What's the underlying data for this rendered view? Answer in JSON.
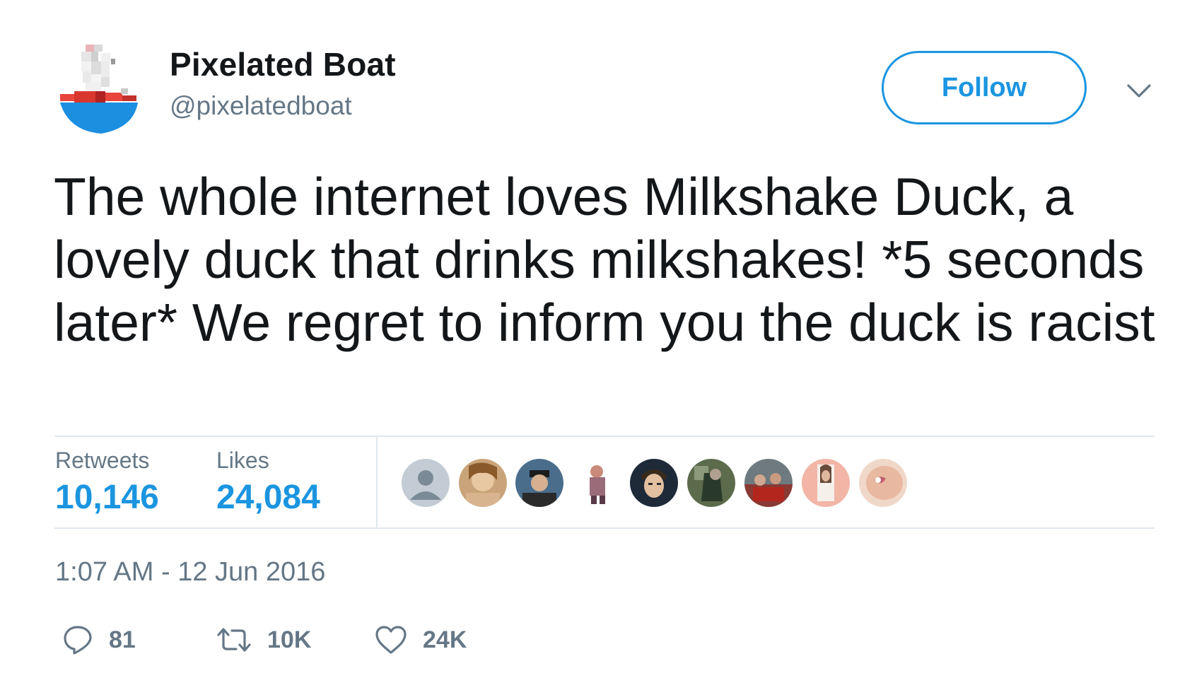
{
  "user": {
    "display_name": "Pixelated Boat",
    "handle": "@pixelatedboat",
    "avatar_icon": "pixelated-boat-avatar"
  },
  "header": {
    "follow_label": "Follow",
    "menu_icon": "chevron-down-icon"
  },
  "tweet": {
    "text": "The whole internet loves Milkshake Duck, a lovely duck that drinks milkshakes! *5 seconds later* We regret to inform you the duck is racist"
  },
  "stats": {
    "retweets_label": "Retweets",
    "retweets_value": "10,146",
    "likes_label": "Likes",
    "likes_value": "24,084",
    "liker_avatar_count": 9
  },
  "timestamp": "1:07 AM - 12 Jun 2016",
  "actions": {
    "reply": {
      "icon": "reply-icon",
      "count": "81"
    },
    "retweet": {
      "icon": "retweet-icon",
      "count": "10K"
    },
    "like": {
      "icon": "heart-icon",
      "count": "24K"
    }
  },
  "colors": {
    "accent": "#1b95e0",
    "text": "#14171a",
    "muted": "#657786",
    "divider": "#e1e8ed"
  }
}
